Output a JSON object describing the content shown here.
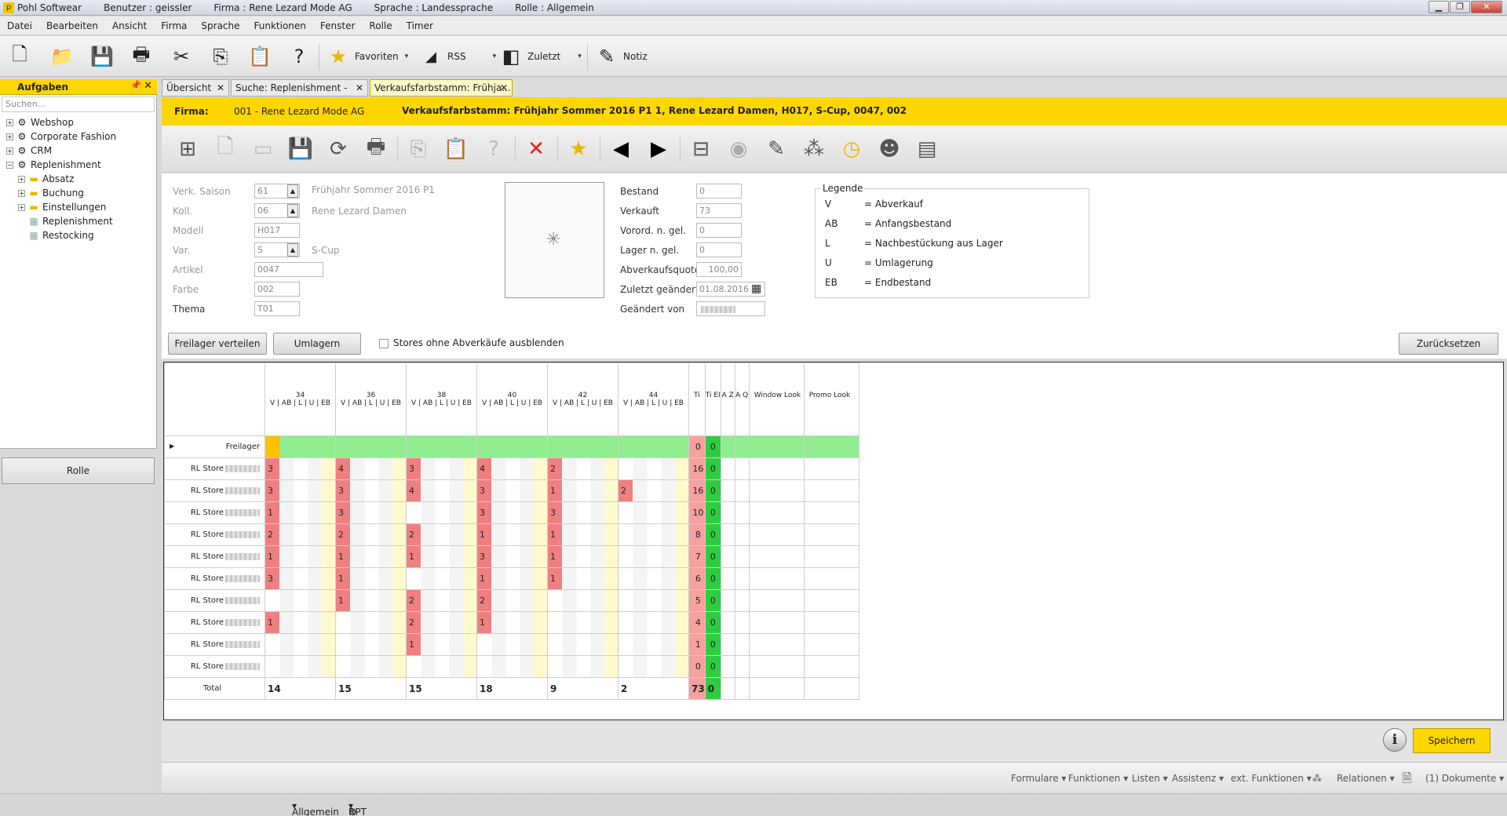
{
  "window": {
    "app": "Pohl Softwear",
    "benutzer": "Benutzer : geissler",
    "firma": "Firma : Rene Lezard Mode AG",
    "sprache": "Sprache : Landessprache",
    "rolle": "Rolle : Allgemein"
  },
  "menu": [
    "Datei",
    "Bearbeiten",
    "Ansicht",
    "Firma",
    "Sprache",
    "Funktionen",
    "Fenster",
    "Rolle",
    "Timer"
  ],
  "toolbar": {
    "favoriten": "Favoriten",
    "rss": "RSS",
    "zuletzt": "Zuletzt",
    "notiz": "Notiz"
  },
  "leftpanel": {
    "title": "Aufgaben",
    "search_placeholder": "Suchen...",
    "rolle": "Rolle",
    "tree": [
      {
        "label": "Webshop",
        "pm": "+"
      },
      {
        "label": "Corporate Fashion",
        "pm": "+"
      },
      {
        "label": "CRM",
        "pm": "+"
      },
      {
        "label": "Replenishment",
        "pm": "−"
      },
      {
        "label": "Absatz",
        "pm": "+"
      },
      {
        "label": "Buchung",
        "pm": "+"
      },
      {
        "label": "Einstellungen",
        "pm": "+"
      },
      {
        "label": "Replenishment",
        "pm": ""
      },
      {
        "label": "Restocking",
        "pm": ""
      }
    ]
  },
  "tabs": [
    "Übersicht",
    "Suche: Replenishment - Pr...",
    "Verkaufsfarbstamm: Frühja..."
  ],
  "firmabar": {
    "label": "Firma:",
    "value": "001 - Rene Lezard Mode AG",
    "title": "Verkaufsfarbstamm: Frühjahr Sommer 2016 P1 1, Rene Lezard Damen, H017, S-Cup, 0047, 002"
  },
  "form": {
    "left": [
      {
        "label": "Verk. Saison",
        "value": "61",
        "desc": "Frühjahr Sommer 2016 P1"
      },
      {
        "label": "Koll.",
        "value": "06",
        "desc": "Rene Lezard Damen"
      },
      {
        "label": "Modell",
        "value": "H017",
        "desc": ""
      },
      {
        "label": "Var.",
        "value": "S",
        "desc": "S-Cup"
      },
      {
        "label": "Artikel",
        "value": "0047",
        "desc": ""
      },
      {
        "label": "Farbe",
        "value": "002",
        "desc": ""
      },
      {
        "label": "Thema",
        "value": "T01",
        "desc": ""
      }
    ],
    "mid": [
      {
        "label": "Bestand",
        "value": "0"
      },
      {
        "label": "Verkauft",
        "value": "73"
      },
      {
        "label": "Vorord. n. gel.",
        "value": "0"
      },
      {
        "label": "Lager n. gel.",
        "value": "0"
      },
      {
        "label": "Abverkaufsquote",
        "value": "100,00"
      },
      {
        "label": "Zuletzt geändert",
        "value": "01.08.2016"
      },
      {
        "label": "Geändert von",
        "value": ""
      }
    ]
  },
  "legend": {
    "title": "Legende",
    "items": [
      {
        "k": "V",
        "v": "= Abverkauf"
      },
      {
        "k": "AB",
        "v": "= Anfangsbestand"
      },
      {
        "k": "L",
        "v": "= Nachbestückung aus Lager"
      },
      {
        "k": "U",
        "v": "= Umlagerung"
      },
      {
        "k": "EB",
        "v": "= Endbestand"
      }
    ]
  },
  "actions": {
    "freilager": "Freilager verteilen",
    "umlagern": "Umlagern",
    "checkbox": "Stores ohne Abverkäufe ausblenden",
    "zuruecksetzen": "Zurücksetzen"
  },
  "grid": {
    "sizes": [
      "34",
      "36",
      "38",
      "40",
      "42",
      "44"
    ],
    "subhdr": "V | AB | L | U | EB",
    "extra_headers": [
      "Ti",
      "Ti EI",
      "A Z",
      "A Q",
      "Window Look",
      "Promo Look"
    ],
    "rows": [
      {
        "label": "Freilager",
        "vals": [
          "",
          "",
          "",
          "",
          "",
          ""
        ],
        "t": "0",
        "e": "0"
      },
      {
        "label": "RL Store",
        "vals": [
          "3",
          "4",
          "3",
          "4",
          "2",
          ""
        ],
        "t": "16",
        "e": "0"
      },
      {
        "label": "RL Store",
        "vals": [
          "3",
          "3",
          "4",
          "3",
          "1",
          "2"
        ],
        "t": "16",
        "e": "0"
      },
      {
        "label": "RL Store",
        "vals": [
          "1",
          "3",
          "",
          "3",
          "3",
          ""
        ],
        "t": "10",
        "e": "0"
      },
      {
        "label": "RL Store",
        "vals": [
          "2",
          "2",
          "2",
          "1",
          "1",
          ""
        ],
        "t": "8",
        "e": "0"
      },
      {
        "label": "RL Store",
        "vals": [
          "1",
          "1",
          "1",
          "3",
          "1",
          ""
        ],
        "t": "7",
        "e": "0"
      },
      {
        "label": "RL Store",
        "vals": [
          "3",
          "1",
          "",
          "1",
          "1",
          ""
        ],
        "t": "6",
        "e": "0"
      },
      {
        "label": "RL Store",
        "vals": [
          "",
          "1",
          "2",
          "2",
          "",
          ""
        ],
        "t": "5",
        "e": "0"
      },
      {
        "label": "RL Store",
        "vals": [
          "1",
          "",
          "2",
          "1",
          "",
          ""
        ],
        "t": "4",
        "e": "0"
      },
      {
        "label": "RL Store",
        "vals": [
          "",
          "",
          "1",
          "",
          "",
          ""
        ],
        "t": "1",
        "e": "0"
      },
      {
        "label": "RL Store",
        "vals": [
          "",
          "",
          "",
          "",
          "",
          ""
        ],
        "t": "0",
        "e": "0"
      }
    ],
    "total": {
      "label": "Total",
      "vals": [
        "14",
        "15",
        "15",
        "18",
        "9",
        "2"
      ],
      "t": "73",
      "e": "0"
    }
  },
  "bottom": {
    "speichern": "Speichern",
    "info": "i"
  },
  "footer": [
    "Formulare",
    "Funktionen",
    "Listen",
    "Assistenz",
    "ext. Funktionen",
    "Relationen",
    "(1) Dokumente"
  ],
  "status": {
    "allgemein": "Allgemein",
    "rpt": "RPT"
  }
}
